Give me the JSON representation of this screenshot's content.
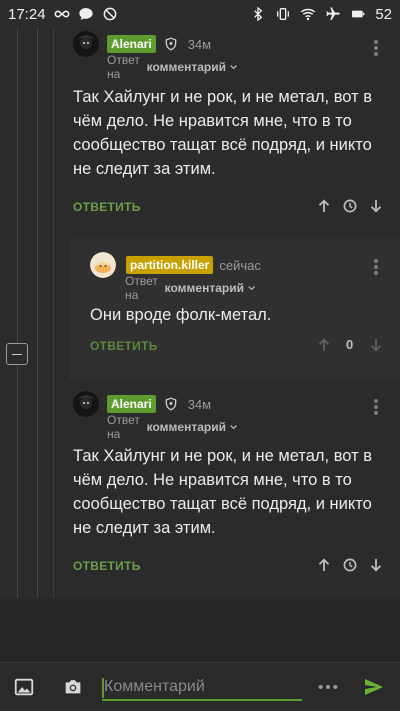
{
  "status_bar": {
    "time": "17:24",
    "battery": "52",
    "icons_left": [
      "infinity-icon",
      "chat-bubble-icon",
      "do-not-disturb-icon"
    ],
    "icons_right": [
      "bluetooth-icon",
      "vibrate-icon",
      "wifi-icon",
      "airplane-icon",
      "battery-icon"
    ]
  },
  "comments": [
    {
      "author": "Alenari",
      "author_badge_color": "#5d9d2f",
      "time": "34м",
      "reply_prefix": "Ответ на",
      "reply_target": "комментарий",
      "text": "Так Хайлунг и не рок, и не метал, вот в чём дело. Не нравится мне, что в то сообщество тащат всё подряд, и никто не следит за этим.",
      "reply_label": "ОТВЕТИТЬ"
    },
    {
      "author": "partition.killer",
      "author_badge_color": "#c8a100",
      "time": "сейчас",
      "reply_prefix": "Ответ на",
      "reply_target": "комментарий",
      "text": "Они вроде фолк-метал.",
      "reply_label": "ОТВЕТИТЬ",
      "score": "0"
    },
    {
      "author": "Alenari",
      "author_badge_color": "#5d9d2f",
      "time": "34м",
      "reply_prefix": "Ответ на",
      "reply_target": "комментарий",
      "text": "Так Хайлунг и не рок, и не метал, вот в чём дело. Не нравится мне, что в то сообщество тащат всё подряд, и никто не следит за этим.",
      "reply_label": "ОТВЕТИТЬ"
    }
  ],
  "composer": {
    "placeholder": "Комментарий",
    "accent": "#5d9d2f"
  }
}
